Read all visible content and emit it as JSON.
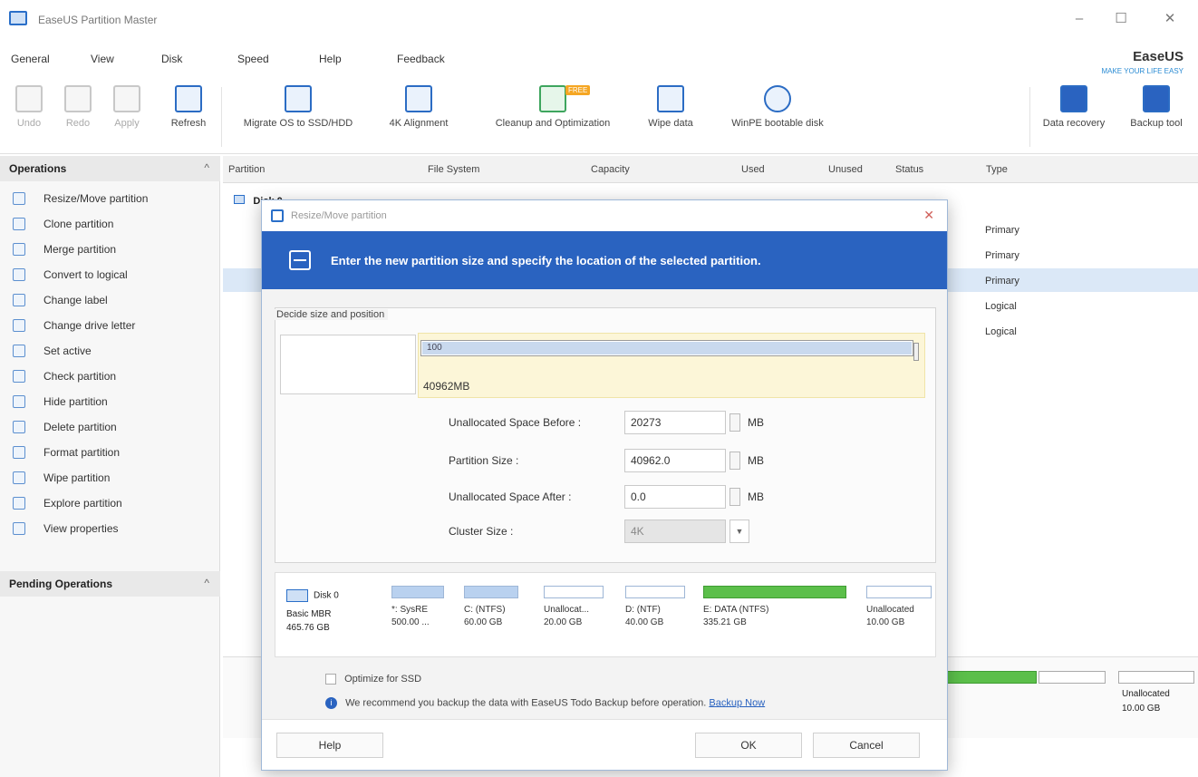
{
  "app": {
    "title": "EaseUS Partition Master",
    "brand": "EaseUS",
    "brand_sub": "MAKE YOUR LIFE EASY"
  },
  "window_controls": {
    "minimize": "–",
    "maximize": "☐",
    "close": "✕"
  },
  "menu": [
    {
      "label": "General"
    },
    {
      "label": "View"
    },
    {
      "label": "Disk"
    },
    {
      "label": "Speed"
    },
    {
      "label": "Help"
    },
    {
      "label": "Feedback"
    }
  ],
  "toolbar": {
    "undo": "Undo",
    "redo": "Redo",
    "apply": "Apply",
    "refresh": "Refresh",
    "migrate": "Migrate OS to SSD/HDD",
    "align": "4K Alignment",
    "cleanup": "Cleanup and Optimization",
    "wipe": "Wipe data",
    "winpe": "WinPE bootable disk",
    "recovery": "Data recovery",
    "backup": "Backup tool",
    "cleanup_badge": "FREE"
  },
  "operations": {
    "title": "Operations",
    "items": [
      "Resize/Move partition",
      "Clone partition",
      "Merge partition",
      "Convert to logical",
      "Change label",
      "Change drive letter",
      "Set active",
      "Check partition",
      "Hide partition",
      "Delete partition",
      "Format partition",
      "Wipe partition",
      "Explore partition",
      "View properties"
    ]
  },
  "pending": {
    "title": "Pending Operations"
  },
  "table": {
    "headers": [
      "Partition",
      "File System",
      "Capacity",
      "Used",
      "Unused",
      "Status",
      "Type"
    ],
    "disk_label": "Disk 0",
    "types": [
      "Primary",
      "Primary",
      "Primary",
      "Logical",
      "Logical"
    ]
  },
  "dialog": {
    "title": "Resize/Move partition",
    "banner": "Enter the new partition size and specify the location of the selected partition.",
    "group_label": "Decide size and position",
    "bar_value": "100",
    "size_value": "40962MB",
    "fields": {
      "before_label": "Unallocated Space Before :",
      "before_value": "20273",
      "size_label": "Partition Size :",
      "size_value": "40962.0",
      "after_label": "Unallocated Space After :",
      "after_value": "0.0",
      "cluster_label": "Cluster Size :",
      "cluster_value": "4K",
      "unit": "MB"
    },
    "strip": {
      "disk_name": "Disk 0",
      "disk_type": "Basic MBR",
      "disk_size": "465.76 GB",
      "partitions": [
        {
          "name": "*: SysRE",
          "size": "500.00 ...",
          "style": "blue"
        },
        {
          "name": "C: (NTFS)",
          "size": "60.00 GB",
          "style": "blue"
        },
        {
          "name": "Unallocat...",
          "size": "20.00 GB",
          "style": "plain"
        },
        {
          "name": "D: (NTF)",
          "size": "40.00 GB",
          "style": "plain"
        },
        {
          "name": "E: DATA (NTFS)",
          "size": "335.21 GB",
          "style": "green"
        },
        {
          "name": "Unallocated",
          "size": "10.00 GB",
          "style": "plain"
        }
      ]
    },
    "optimize_label": "Optimize for SSD",
    "note": "We recommend you backup the data with EaseUS Todo Backup before operation.",
    "note_link": "Backup Now",
    "buttons": {
      "help": "Help",
      "ok": "OK",
      "cancel": "Cancel"
    }
  },
  "diskmap": {
    "unalloc_label": "Unallocated",
    "unalloc_size": "10.00 GB"
  },
  "colors": {
    "accent": "#2a63c0",
    "selection": "#dbe8f7",
    "highlight": "#fcf6d8",
    "used_green": "#5bbf4a"
  }
}
